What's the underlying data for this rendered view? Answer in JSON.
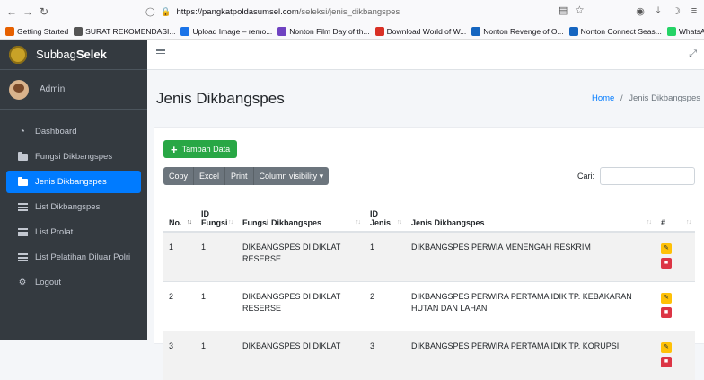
{
  "browser": {
    "url_host": "https://pangkatpoldasumsel.com",
    "url_path": "/seleksi/jenis_dikbangspes",
    "bookmarks": [
      {
        "label": "Getting Started",
        "color": "#e66000"
      },
      {
        "label": "SURAT REKOMENDASI...",
        "color": "#555555"
      },
      {
        "label": "Upload Image – remo...",
        "color": "#1a73e8"
      },
      {
        "label": "Nonton Film Day of th...",
        "color": "#6f42c1"
      },
      {
        "label": "Download World of W...",
        "color": "#d93025"
      },
      {
        "label": "Nonton Revenge of O...",
        "color": "#1565c0"
      },
      {
        "label": "Nonton Connect Seas...",
        "color": "#1565c0"
      },
      {
        "label": "WhatsApp",
        "color": "#25d366"
      }
    ]
  },
  "brand": {
    "part1": "Subbag",
    "part2": "Selek"
  },
  "user": {
    "name": "Admin"
  },
  "menu": [
    {
      "label": "Dashboard",
      "icon": "dashboard-icon",
      "active": false
    },
    {
      "label": "Fungsi Dikbangspes",
      "icon": "folder-icon",
      "active": false
    },
    {
      "label": "Jenis Dikbangspes",
      "icon": "folder-icon",
      "active": true
    },
    {
      "label": "List Dikbangspes",
      "icon": "list-icon",
      "active": false
    },
    {
      "label": "List Prolat",
      "icon": "list-icon",
      "active": false
    },
    {
      "label": "List Pelatihan Diluar Polri",
      "icon": "list-icon",
      "active": false
    },
    {
      "label": "Logout",
      "icon": "gear-icon",
      "active": false
    }
  ],
  "page": {
    "title": "Jenis Dikbangspes",
    "breadcrumb_home": "Home",
    "breadcrumb_sep": "/",
    "breadcrumb_current": "Jenis Dikbangspes"
  },
  "toolbar": {
    "add_label": "Tambah Data",
    "buttons": [
      "Copy",
      "Excel",
      "Print",
      "Column visibility ▾"
    ],
    "search_label": "Cari:",
    "search_value": ""
  },
  "table": {
    "headers": [
      "No.",
      "ID Fungsi",
      "Fungsi Dikbangspes",
      "ID Jenis",
      "Jenis Dikbangspes",
      "#"
    ],
    "rows": [
      {
        "no": "1",
        "id_fungsi": "1",
        "fungsi": "DIKBANGSPES DI DIKLAT RESERSE",
        "id_jenis": "1",
        "jenis": "DIKBANGSPES PERWIA MENENGAH RESKRIM"
      },
      {
        "no": "2",
        "id_fungsi": "1",
        "fungsi": "DIKBANGSPES DI DIKLAT RESERSE",
        "id_jenis": "2",
        "jenis": "DIKBANGSPES PERWIRA PERTAMA IDIK TP. KEBAKARAN HUTAN DAN LAHAN"
      },
      {
        "no": "3",
        "id_fungsi": "1",
        "fungsi": "DIKBANGSPES DI DIKLAT",
        "id_jenis": "3",
        "jenis": "DIKBANGSPES PERWIRA PERTAMA IDIK TP. KORUPSI"
      }
    ]
  },
  "colors": {
    "primary": "#007bff",
    "success": "#28a745",
    "warning": "#ffc107",
    "danger": "#dc3545",
    "sidebar": "#343a40"
  }
}
